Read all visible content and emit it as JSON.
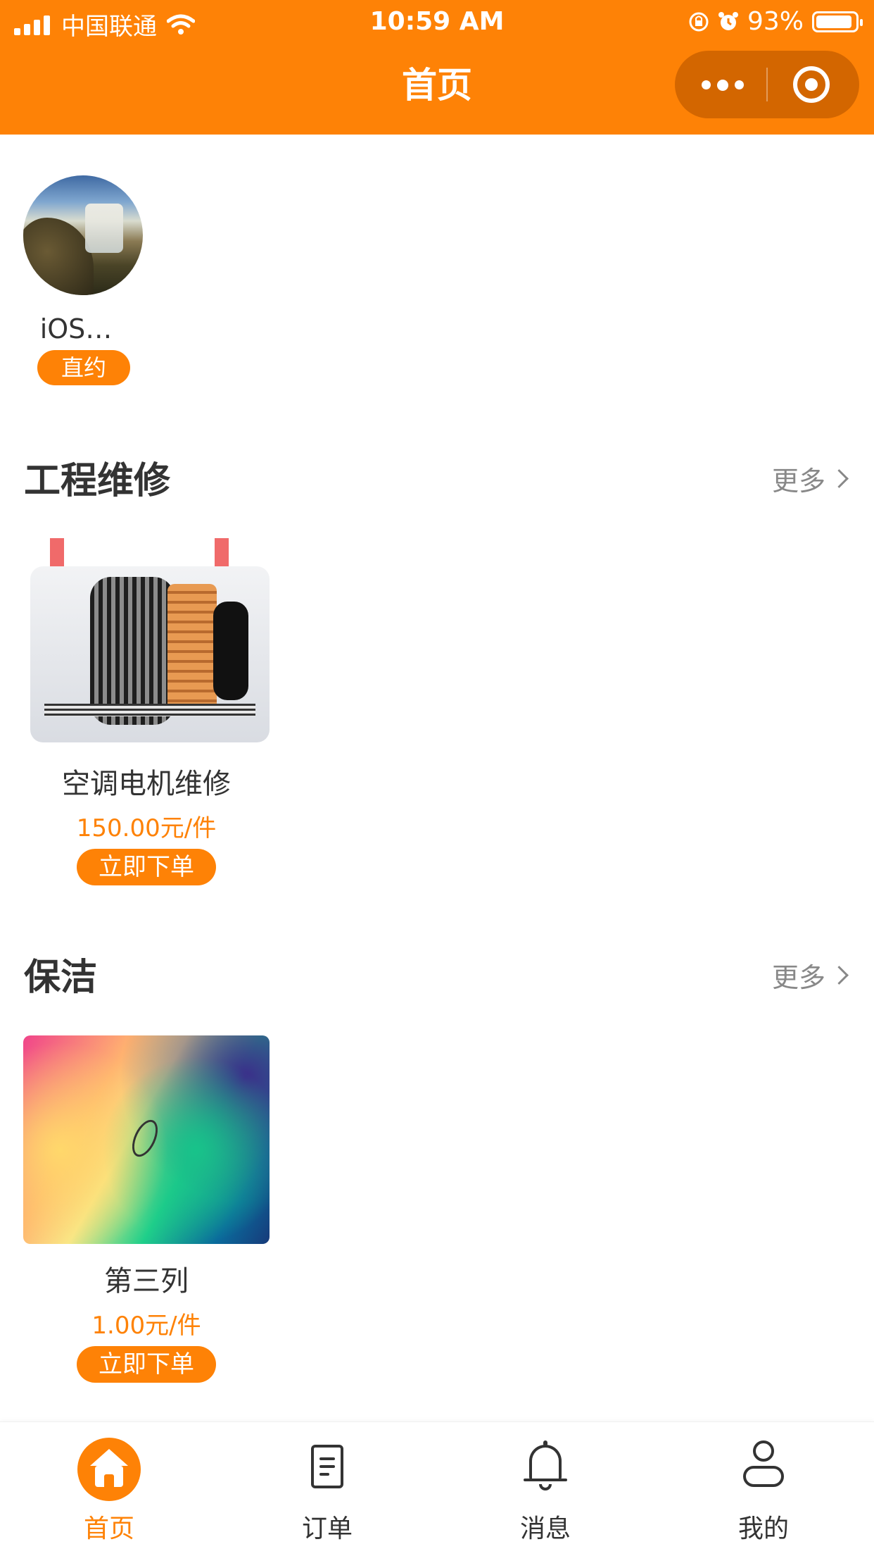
{
  "status_bar": {
    "carrier": "中国联通",
    "time": "10:59 AM",
    "battery_percent": "93%",
    "battery_level": 0.93
  },
  "nav": {
    "title": "首页",
    "capsule": {
      "more_icon": "more-dots-icon",
      "close_icon": "target-circle-icon"
    }
  },
  "worker": {
    "name": "iOS…",
    "badge": "直约"
  },
  "sections": [
    {
      "title": "工程维修",
      "more_label": "更多",
      "products": [
        {
          "name": "空调电机维修",
          "price": "150.00元/件",
          "button": "立即下单"
        }
      ]
    },
    {
      "title": "保洁",
      "more_label": "更多",
      "products": [
        {
          "name": "第三列",
          "price": "1.00元/件",
          "button": "立即下单"
        }
      ]
    }
  ],
  "tabbar": {
    "items": [
      {
        "label": "首页",
        "icon": "home-icon",
        "active": true
      },
      {
        "label": "订单",
        "icon": "document-icon",
        "active": false
      },
      {
        "label": "消息",
        "icon": "bell-icon",
        "active": false
      },
      {
        "label": "我的",
        "icon": "user-icon",
        "active": false
      }
    ]
  },
  "colors": {
    "accent": "#fe8206",
    "text": "#333333",
    "muted": "#888888"
  }
}
